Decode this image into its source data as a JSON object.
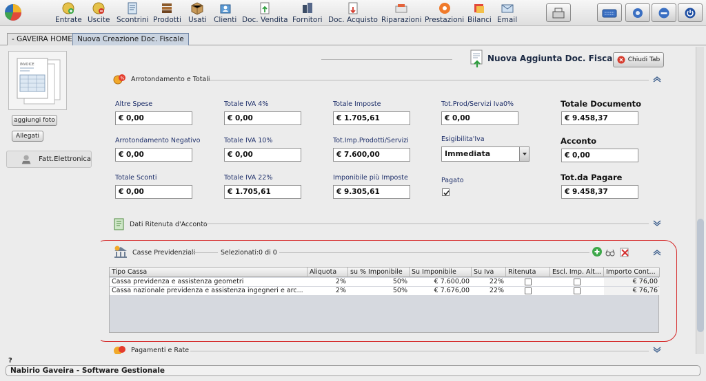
{
  "toolbar": {
    "items": [
      {
        "label": "Entrate",
        "icon": "coin-in-icon"
      },
      {
        "label": "Uscite",
        "icon": "coin-out-icon"
      },
      {
        "label": "Scontrini",
        "icon": "receipt-icon"
      },
      {
        "label": "Prodotti",
        "icon": "books-icon"
      },
      {
        "label": "Usati",
        "icon": "box-icon"
      },
      {
        "label": "Clienti",
        "icon": "customer-icon"
      },
      {
        "label": "Doc. Vendita",
        "icon": "sales-doc-icon"
      },
      {
        "label": "Fornitori",
        "icon": "supplier-icon"
      },
      {
        "label": "Doc. Acquisto",
        "icon": "purchase-doc-icon"
      },
      {
        "label": "Riparazioni",
        "icon": "repair-icon"
      },
      {
        "label": "Prestazioni",
        "icon": "service-icon"
      },
      {
        "label": "Bilanci",
        "icon": "balance-icon"
      },
      {
        "label": "Email",
        "icon": "email-icon"
      }
    ],
    "right_buttons": [
      "cash-register-icon",
      "keyboard-icon",
      "settings-icon",
      "minimize-icon",
      "power-icon"
    ]
  },
  "tabs": [
    {
      "label": "- GAVEIRA HOME -",
      "active": false
    },
    {
      "label": "Nuova Creazione Doc. Fiscale",
      "active": true
    }
  ],
  "sidebar": {
    "add_photo": "aggiungi foto",
    "attachments": "Allegati",
    "e_invoice": "Fatt.Elettronica",
    "thumb_title": "INVOICE"
  },
  "header": {
    "title": "Nuova Aggiunta Doc. Fiscale",
    "close_tab": "Chiudi Tab"
  },
  "sections": {
    "totals": "Arrotondamento e Totali",
    "withholding": "Dati Ritenuta d'Acconto",
    "pension": "Casse Previdenziali",
    "selected_label": "Selezionati:",
    "selected_value": "0 di 0",
    "payments": "Pagamenti e Rate"
  },
  "fields": {
    "altre_spese": {
      "label": "Altre Spese",
      "value": "€ 0,00"
    },
    "iva4": {
      "label": "Totale IVA  4%",
      "value": "€ 0,00"
    },
    "imposte": {
      "label": "Totale Imposte",
      "value": "€ 1.705,61"
    },
    "prod_iva0": {
      "label": "Tot.Prod/Servizi Iva0%",
      "value": "€ 0,00"
    },
    "totale_doc": {
      "label": "Totale Documento",
      "value": "€ 9.458,37"
    },
    "arr_neg": {
      "label": "Arrotondamento Negativo",
      "value": "€ 0,00"
    },
    "iva10": {
      "label": "Totale IVA  10%",
      "value": "€ 0,00"
    },
    "imp_prod": {
      "label": "Tot.Imp.Prodotti/Servizi",
      "value": "€ 7.600,00"
    },
    "esigibilita": {
      "label": "Esigibilita'Iva",
      "value": "Immediata"
    },
    "acconto": {
      "label": "Acconto",
      "value": "€ 0,00"
    },
    "sconti": {
      "label": "Totale Sconti",
      "value": "€ 0,00"
    },
    "iva22": {
      "label": "Totale IVA  22%",
      "value": "€ 1.705,61"
    },
    "imponibile_imposte": {
      "label": "Imponibile più Imposte",
      "value": "€ 9.305,61"
    },
    "pagato": {
      "label": "Pagato",
      "checked": true
    },
    "da_pagare": {
      "label": "Tot.da Pagare",
      "value": "€ 9.458,37"
    }
  },
  "table": {
    "columns": [
      "Tipo Cassa",
      "Aliquota",
      "su % Imponibile",
      "Su Imponibile",
      "Su Iva",
      "Ritenuta",
      "Escl. Imp. Alt...",
      "Importo Cont..."
    ],
    "rows": [
      [
        "Cassa previdenza e assistenza geometri",
        "2%",
        "50%",
        "€ 7.600,00",
        "22%",
        false,
        false,
        "€ 76,00"
      ],
      [
        "Cassa nazionale previdenza e assistenza ingegneri e arc...",
        "2%",
        "50%",
        "€ 7.676,00",
        "22%",
        false,
        false,
        "€ 76,76"
      ]
    ]
  },
  "status": {
    "help": "?",
    "text": "Nabirio Gaveira - Software Gestionale"
  },
  "colors": {
    "highlight": "#d52525",
    "label_blue": "#1e2f6a"
  }
}
